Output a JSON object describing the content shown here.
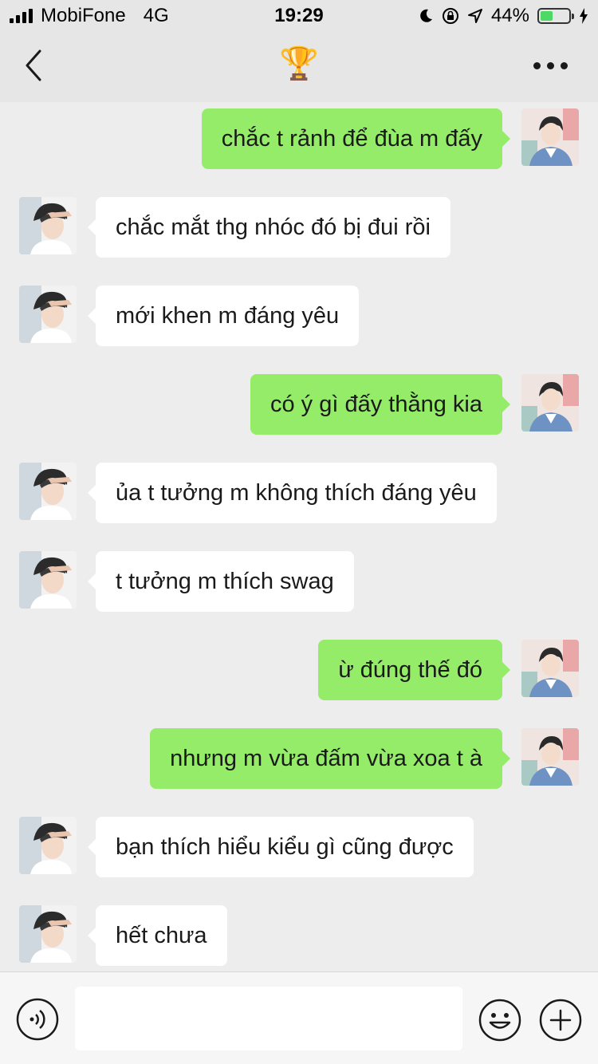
{
  "status": {
    "carrier": "MobiFone",
    "network": "4G",
    "time": "19:29",
    "battery": "44%",
    "battery_level": 0.44
  },
  "header": {
    "title": "🏆"
  },
  "messages": [
    {
      "side": "right",
      "text": "chắc t rảnh để đùa m đấy"
    },
    {
      "side": "left",
      "text": "chắc mắt thg nhóc đó bị đui rồi"
    },
    {
      "side": "left",
      "text": "mới khen m đáng yêu"
    },
    {
      "side": "right",
      "text": "có ý gì đấy thằng kia"
    },
    {
      "side": "left",
      "text": "ủa t tưởng m không thích đáng yêu"
    },
    {
      "side": "left",
      "text": "t tưởng m thích swag"
    },
    {
      "side": "right",
      "text": "ừ đúng thế đó"
    },
    {
      "side": "right",
      "text": "nhưng m vừa đấm vừa xoa t à"
    },
    {
      "side": "left",
      "text": "bạn thích hiểu kiểu gì cũng được"
    },
    {
      "side": "left",
      "text": "hết chưa"
    }
  ],
  "input": {
    "placeholder": "",
    "value": ""
  },
  "icons": {
    "back": "chevron-left-icon",
    "more": "more-dots-icon",
    "voice": "voice-icon",
    "emoji": "emoji-icon",
    "plus": "plus-icon"
  },
  "colors": {
    "outgoing": "#95ec69",
    "incoming": "#ffffff",
    "background": "#ededed"
  }
}
